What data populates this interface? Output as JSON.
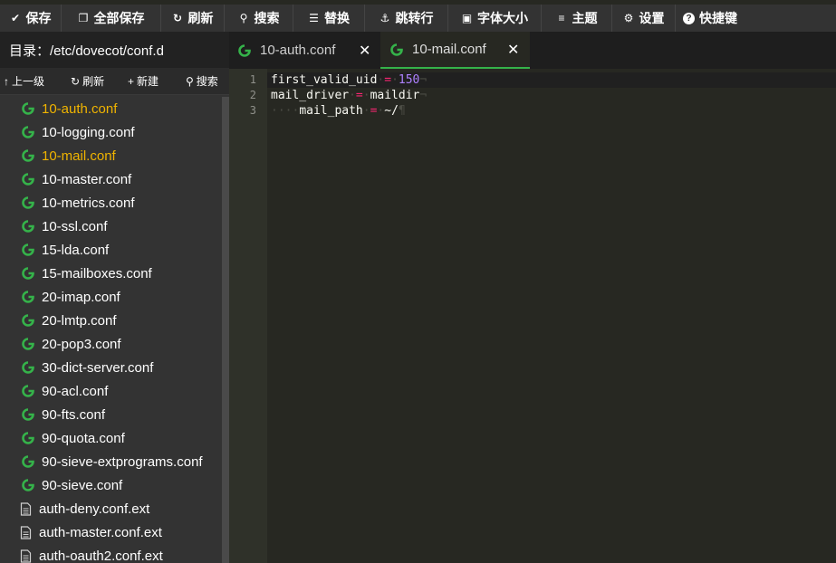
{
  "toolbar": {
    "items": [
      {
        "label": "保存",
        "icon": "check-icon"
      },
      {
        "label": "全部保存",
        "icon": "copy-icon"
      },
      {
        "label": "刷新",
        "icon": "refresh-icon"
      },
      {
        "label": "搜索",
        "icon": "search-icon"
      },
      {
        "label": "替换",
        "icon": "replace-icon"
      },
      {
        "label": "跳转行",
        "icon": "jump-icon"
      },
      {
        "label": "字体大小",
        "icon": "font-size-icon"
      },
      {
        "label": "主题",
        "icon": "menu-icon"
      },
      {
        "label": "设置",
        "icon": "gear-icon"
      },
      {
        "label": "快捷键",
        "icon": "help-icon"
      }
    ]
  },
  "sidebar": {
    "directory_label": "目录：/etc/dovecot/conf.d",
    "actions": [
      {
        "label": "上一级",
        "icon": "arrow-up-icon"
      },
      {
        "label": "刷新",
        "icon": "refresh-icon"
      },
      {
        "label": "新建",
        "icon": "plus-icon"
      },
      {
        "label": "搜索",
        "icon": "search-icon"
      }
    ],
    "files": [
      {
        "name": "10-auth.conf",
        "type": "conf",
        "active": true
      },
      {
        "name": "10-logging.conf",
        "type": "conf",
        "active": false
      },
      {
        "name": "10-mail.conf",
        "type": "conf",
        "active": true
      },
      {
        "name": "10-master.conf",
        "type": "conf",
        "active": false
      },
      {
        "name": "10-metrics.conf",
        "type": "conf",
        "active": false
      },
      {
        "name": "10-ssl.conf",
        "type": "conf",
        "active": false
      },
      {
        "name": "15-lda.conf",
        "type": "conf",
        "active": false
      },
      {
        "name": "15-mailboxes.conf",
        "type": "conf",
        "active": false
      },
      {
        "name": "20-imap.conf",
        "type": "conf",
        "active": false
      },
      {
        "name": "20-lmtp.conf",
        "type": "conf",
        "active": false
      },
      {
        "name": "20-pop3.conf",
        "type": "conf",
        "active": false
      },
      {
        "name": "30-dict-server.conf",
        "type": "conf",
        "active": false
      },
      {
        "name": "90-acl.conf",
        "type": "conf",
        "active": false
      },
      {
        "name": "90-fts.conf",
        "type": "conf",
        "active": false
      },
      {
        "name": "90-quota.conf",
        "type": "conf",
        "active": false
      },
      {
        "name": "90-sieve-extprograms.conf",
        "type": "conf",
        "active": false
      },
      {
        "name": "90-sieve.conf",
        "type": "conf",
        "active": false
      },
      {
        "name": "auth-deny.conf.ext",
        "type": "ext",
        "active": false
      },
      {
        "name": "auth-master.conf.ext",
        "type": "ext",
        "active": false
      },
      {
        "name": "auth-oauth2.conf.ext",
        "type": "ext",
        "active": false
      }
    ]
  },
  "tabs": [
    {
      "label": "10-auth.conf",
      "active": false,
      "close": "✕"
    },
    {
      "label": "10-mail.conf",
      "active": true,
      "close": "✕"
    }
  ],
  "editor": {
    "line_numbers": [
      "1",
      "2",
      "3"
    ],
    "lines": [
      {
        "indent": "",
        "key": "first_valid_uid",
        "sep": "=",
        "value": "150",
        "value_type": "number",
        "eol": "¬"
      },
      {
        "indent": "",
        "key": "mail_driver",
        "sep": "=",
        "value": "maildir",
        "value_type": "string",
        "eol": "¬"
      },
      {
        "indent": "····",
        "key": "mail_path",
        "sep": "=",
        "value": "~/",
        "value_type": "string",
        "eol": "¶"
      }
    ]
  },
  "colors": {
    "accent_green": "#35b34a",
    "active_file": "#f0b400",
    "toolbar_bg": "#333333",
    "editor_bg": "#272822"
  }
}
